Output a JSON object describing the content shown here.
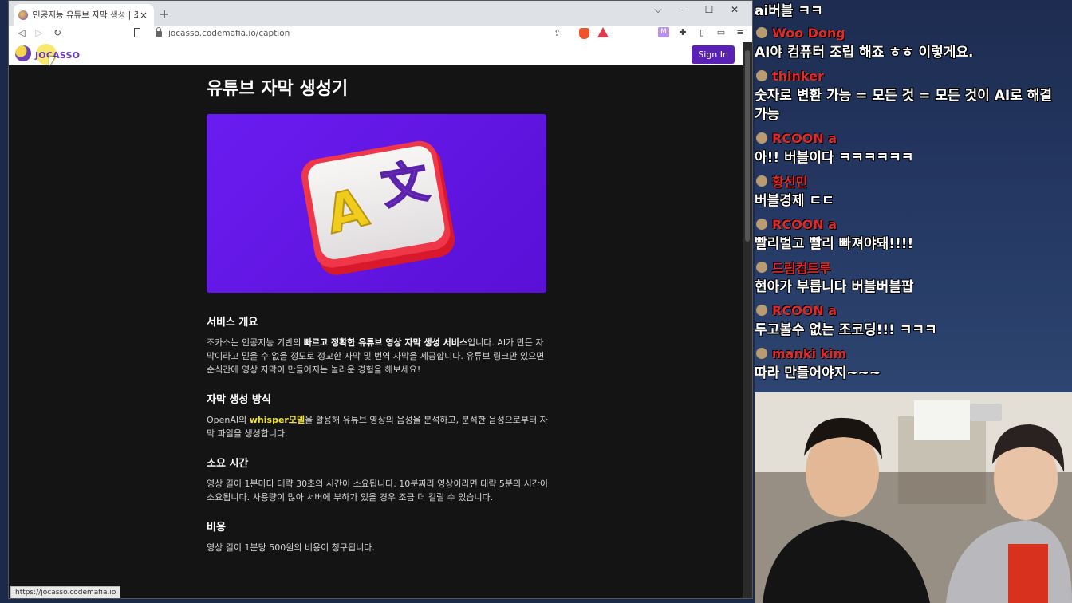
{
  "browser": {
    "tab_title": "인공지능 유튜브 자막 생성 | 조카",
    "tab_close": "×",
    "new_tab": "+",
    "window_controls": [
      "⌵",
      "–",
      "☐",
      "✕"
    ],
    "nav": {
      "back": "◁",
      "forward": "▷",
      "reload": "↻"
    },
    "url": "jocasso.codemafia.io/caption",
    "ext_m": "M",
    "status_url": "https://jocasso.codemafia.io"
  },
  "site": {
    "logo_text": "JOCASSO",
    "signin_label": "Sign In",
    "page_title": "유튜브 자막 생성기",
    "sections": {
      "overview_title": "서비스 개요",
      "overview_pre": "조카소는 인공지능 기반의 ",
      "overview_bold": "빠르고 정확한 유튜브 영상 자막 생성 서비스",
      "overview_post": "입니다. AI가 만든 자막이라고 믿을 수 없을 정도로 정교한 자막 및 번역 자막을 제공합니다. 유튜브 링크만 있으면 순식간에 영상 자막이 만들어지는 놀라운 경험을 해보세요!",
      "method_title": "자막 생성 방식",
      "method_pre": "OpenAI의 ",
      "method_highlight": "whisper모델",
      "method_post": "을 활용해 유튜브 영상의 음성을 분석하고, 분석한 음성으로부터 자막 파일을 생성합니다.",
      "time_title": "소요 시간",
      "time_text": "영상 길이 1분마다 대략 30초의 시간이 소요됩니다. 10분짜리 영상이라면 대략 5분의 시간이 소요됩니다. 사용량이 많아 서버에 부하가 있을 경우 조금 더 걸릴 수 있습니다.",
      "cost_title": "비용",
      "cost_text": "영상 길이 1분당 500원의 비용이 청구됩니다."
    }
  },
  "chat": {
    "first_text": "ai버블 ㅋㅋ",
    "messages": [
      {
        "name": "Woo Dong",
        "text": "AI야 컴퓨터 조립 해죠 ㅎㅎ 이렇게요."
      },
      {
        "name": "thinker",
        "text": "숫자로 변환 가능 = 모든 것 = 모든 것이 AI로 해결 가능"
      },
      {
        "name": "RCOON a",
        "text": "아!! 버블이다 ㅋㅋㅋㅋㅋㅋ"
      },
      {
        "name": "황선민",
        "text": "버블경제 ㄷㄷ"
      },
      {
        "name": "RCOON a",
        "text": "빨리벌고 빨리 빠져야돼!!!!"
      },
      {
        "name": "드림컴트루",
        "text": "현아가 부릅니다 버블버블팝"
      },
      {
        "name": "RCOON a",
        "text": "두고볼수 없는 조코딩!!! ㅋㅋㅋ"
      },
      {
        "name": "manki kim",
        "text": "따라 만들어야지~~~"
      }
    ]
  },
  "colors": {
    "accent": "#5b21b6",
    "hero_bg": "#6a1cf0",
    "chat_name": "#e02a2a",
    "highlight_text": "#f2e43a"
  }
}
